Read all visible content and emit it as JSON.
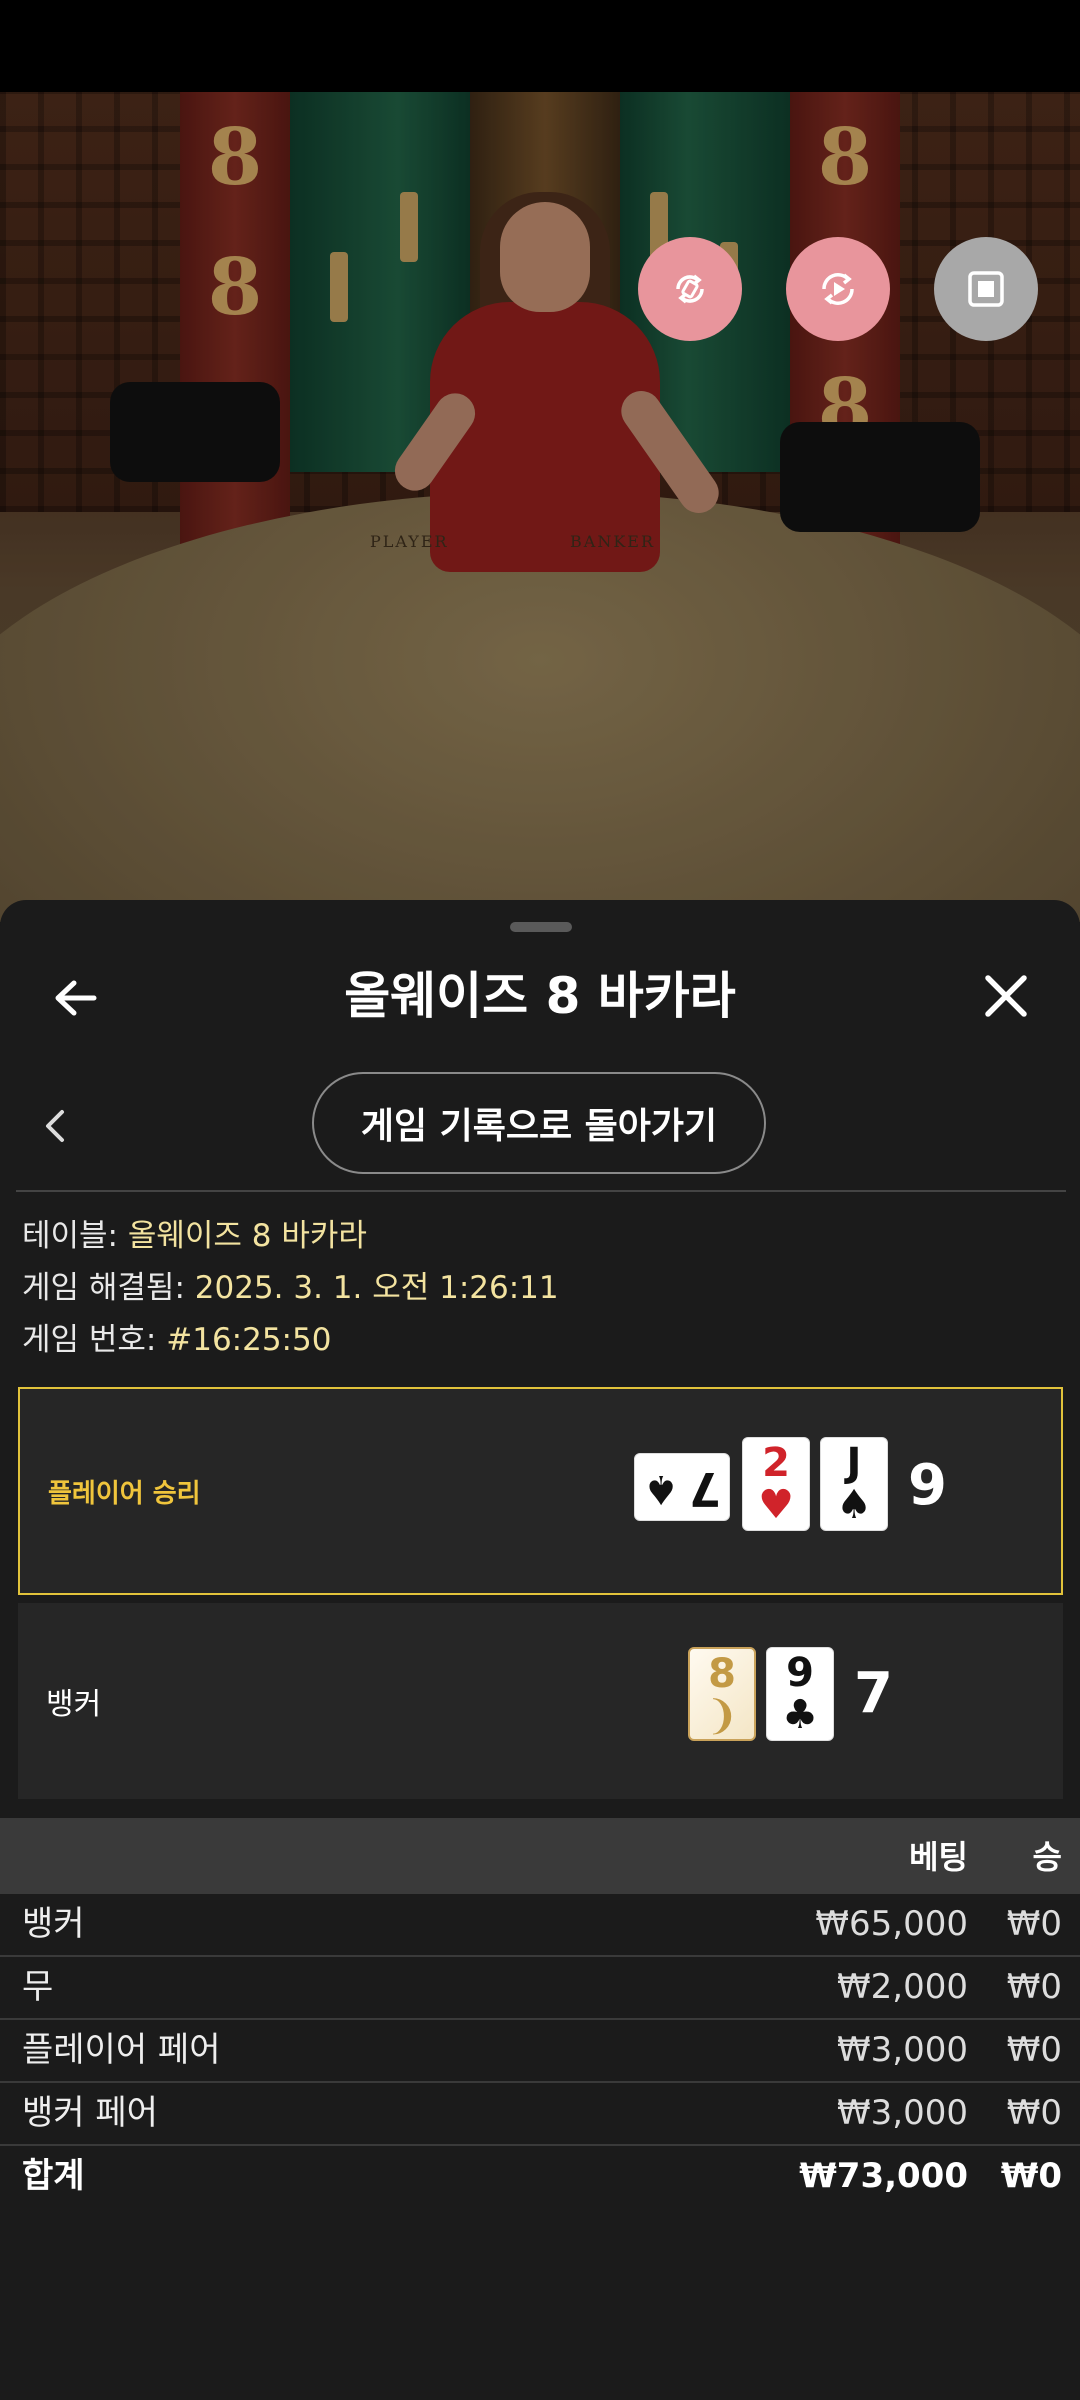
{
  "colors": {
    "accent_gold": "#e2c33b",
    "fab_pink": "#e8959c",
    "fab_gray": "#a8a8a8"
  },
  "video": {
    "table_labels": [
      "PLAYER",
      "BANKER"
    ],
    "pillar_digit": "8"
  },
  "sheet": {
    "title": "올웨이즈 8 바카라",
    "back_history_label": "게임 기록으로 돌아가기"
  },
  "info": {
    "table_label": "테이블:",
    "table_value": "올웨이즈 8 바카라",
    "resolved_label": "게임 해결됨:",
    "resolved_value": "2025. 3. 1. 오전 1:26:11",
    "number_label": "게임 번호:",
    "number_value": "#16:25:50"
  },
  "results": {
    "player": {
      "label": "플레이어 승리",
      "cards": [
        {
          "rank": "7",
          "suit": "♠",
          "color": "black",
          "orientation": "sideways"
        },
        {
          "rank": "2",
          "suit": "♥",
          "color": "red"
        },
        {
          "rank": "J",
          "suit": "♠",
          "color": "black"
        }
      ],
      "score": "9"
    },
    "banker": {
      "label": "뱅커",
      "cards": [
        {
          "rank": "8",
          "suit": "❩",
          "color": "gold"
        },
        {
          "rank": "9",
          "suit": "♣",
          "color": "black"
        }
      ],
      "score": "7"
    }
  },
  "bets": {
    "headers": {
      "bet": "베팅",
      "win": "승"
    },
    "rows": [
      {
        "name": "뱅커",
        "amount": "₩65,000",
        "win": "₩0"
      },
      {
        "name": "무",
        "amount": "₩2,000",
        "win": "₩0"
      },
      {
        "name": "플레이어 페어",
        "amount": "₩3,000",
        "win": "₩0"
      },
      {
        "name": "뱅커 페어",
        "amount": "₩3,000",
        "win": "₩0"
      }
    ],
    "total": {
      "name": "합계",
      "amount": "₩73,000",
      "win": "₩0"
    }
  }
}
